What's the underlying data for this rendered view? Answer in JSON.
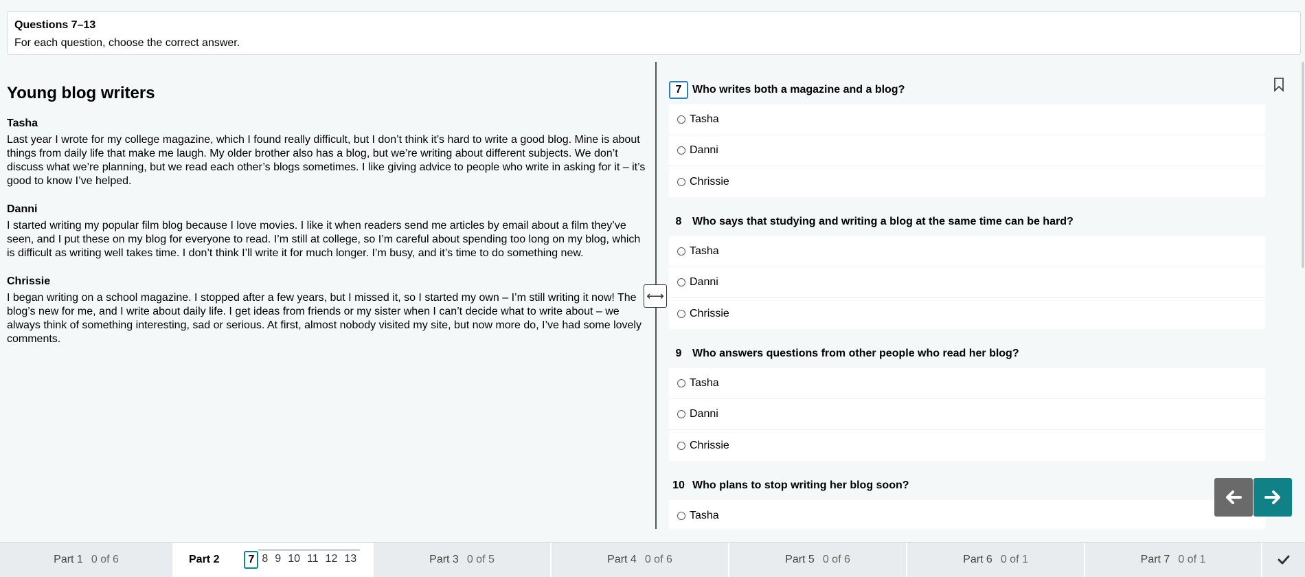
{
  "instructions": {
    "title": "Questions 7–13",
    "subtitle": "For each question, choose the correct answer."
  },
  "passage": {
    "title": "Young blog writers",
    "paragraphs": [
      {
        "name": "Tasha",
        "text": "Last year I wrote for my college magazine, which I found really difficult, but I don’t think it’s hard to write a good blog. Mine is about things from daily life that make me laugh. My older brother also has a blog, but we’re writing about different subjects. We don’t discuss what we’re planning, but we read each other’s blogs sometimes. I like giving advice to people who write in asking for it – it’s good to know I’ve helped."
      },
      {
        "name": "Danni",
        "text": "I started writing my popular film blog because I love movies. I like it when readers send me articles by email about a film they’ve seen, and I put these on my blog for everyone to read. I’m still at college, so I’m careful about spending too long on my blog, which is difficult as writing well takes time. I don’t think I’ll write it for much longer. I’m busy, and it’s time to do something new."
      },
      {
        "name": "Chrissie",
        "text": "I began writing on a school magazine. I stopped after a few years, but I missed it, so I started my own – I’m still writing it now! The blog’s new for me, and I write about daily life. I get ideas from friends or my sister when I can’t decide what to write about – we always think of something interesting, sad or serious. At first, almost nobody visited my site, but now more do, I’ve had some lovely comments."
      }
    ]
  },
  "questions": [
    {
      "number": "7",
      "text": "Who writes both a magazine and a blog?",
      "options": [
        "Tasha",
        "Danni",
        "Chrissie"
      ]
    },
    {
      "number": "8",
      "text": "Who says that studying and writing a blog at the same time can be hard?",
      "options": [
        "Tasha",
        "Danni",
        "Chrissie"
      ]
    },
    {
      "number": "9",
      "text": "Who answers questions from other people who read her blog?",
      "options": [
        "Tasha",
        "Danni",
        "Chrissie"
      ]
    },
    {
      "number": "10",
      "text": "Who plans to stop writing her blog soon?",
      "options": [
        "Tasha"
      ]
    }
  ],
  "footer": {
    "parts": [
      {
        "label": "Part 1",
        "progress": "0 of 6"
      },
      {
        "label": "Part 2",
        "progress": ""
      },
      {
        "label": "Part 3",
        "progress": "0 of 5"
      },
      {
        "label": "Part 4",
        "progress": "0 of 6"
      },
      {
        "label": "Part 5",
        "progress": "0 of 6"
      },
      {
        "label": "Part 6",
        "progress": "0 of 1"
      },
      {
        "label": "Part 7",
        "progress": "0 of 1"
      }
    ],
    "question_links": [
      "7",
      "8",
      "9",
      "10",
      "11",
      "12",
      "13"
    ]
  },
  "icons": {
    "splitter": "resize-horizontal-icon",
    "bookmark": "bookmark-icon",
    "prev": "arrow-left-icon",
    "next": "arrow-right-icon",
    "finish": "check-icon"
  },
  "colors": {
    "accent": "#0f8187",
    "prev_button": "#6a6a6a",
    "active_question_border": "#2a7fbf"
  }
}
